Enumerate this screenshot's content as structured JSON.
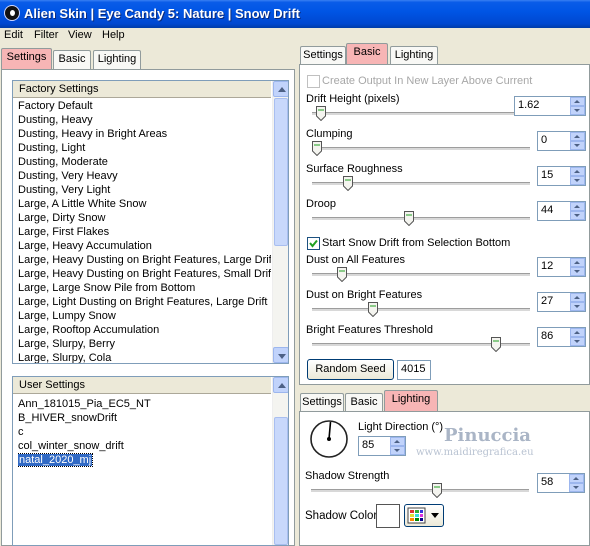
{
  "window": {
    "title": "Alien Skin | Eye Candy 5: Nature | Snow Drift"
  },
  "menu": [
    "Edit",
    "Filter",
    "View",
    "Help"
  ],
  "left_tabs": [
    "Settings",
    "Basic",
    "Lighting"
  ],
  "factory": {
    "header": "Factory Settings",
    "items": [
      "Factory Default",
      "Dusting, Heavy",
      "Dusting, Heavy in Bright Areas",
      "Dusting, Light",
      "Dusting, Moderate",
      "Dusting, Very Heavy",
      "Dusting, Very Light",
      "Large, A Little White Snow",
      "Large, Dirty Snow",
      "Large, First Flakes",
      "Large, Heavy Accumulation",
      "Large, Heavy Dusting on Bright Features, Large Drift",
      "Large, Heavy Dusting on Bright Features, Small Drift",
      "Large, Large Snow Pile from Bottom",
      "Large, Light Dusting on Bright Features, Large Drift",
      "Large, Lumpy Snow",
      "Large, Rooftop Accumulation",
      "Large, Slurpy, Berry",
      "Large, Slurpy, Cola"
    ]
  },
  "user": {
    "header": "User Settings",
    "items": [
      "Ann_181015_Pia_EC5_NT",
      "B_HIVER_snowDrift",
      "c",
      "col_winter_snow_drift",
      "natal_2020_mj"
    ],
    "selected": "natal_2020_mj"
  },
  "right_tabs": [
    "Settings",
    "Basic",
    "Lighting"
  ],
  "basic": {
    "create_output": "Create Output In New Layer Above Current",
    "drift_height": {
      "label": "Drift Height (pixels)",
      "value": "1.62",
      "level": 0.02
    },
    "clumping": {
      "label": "Clumping",
      "value": "0",
      "level": 0.0
    },
    "surface_roughness": {
      "label": "Surface Roughness",
      "value": "15",
      "level": 0.15
    },
    "droop": {
      "label": "Droop",
      "value": "44",
      "level": 0.44
    },
    "start_drift": "Start Snow Drift from Selection Bottom",
    "dust_all": {
      "label": "Dust on All Features",
      "value": "12",
      "level": 0.12
    },
    "dust_bright": {
      "label": "Dust on Bright Features",
      "value": "27",
      "level": 0.27
    },
    "bright_threshold": {
      "label": "Bright Features Threshold",
      "value": "86",
      "level": 0.86
    },
    "random_seed_label": "Random Seed",
    "random_seed_value": "4015"
  },
  "lower_tabs": [
    "Settings",
    "Basic",
    "Lighting"
  ],
  "lighting": {
    "light_direction_label": "Light Direction (°)",
    "light_direction_value": "85",
    "shadow_strength": {
      "label": "Shadow Strength",
      "value": "58",
      "level": 0.58
    },
    "shadow_color_label": "Shadow Color"
  },
  "watermark": {
    "name": "Pinuccia",
    "url": "www.maidiregrafica.eu"
  },
  "colors": {
    "title_bar": "#0055e5",
    "highlight_tab": "#f7b5b5",
    "selection": "#316ac5"
  }
}
